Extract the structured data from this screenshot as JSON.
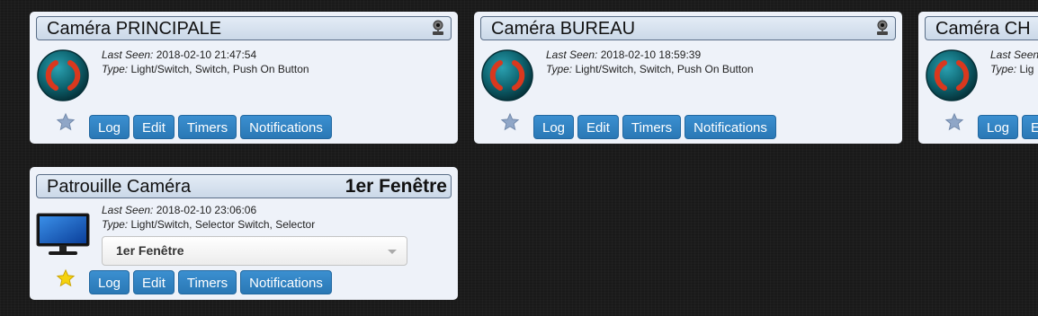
{
  "colors": {
    "background": "#1c1c1c",
    "card": "#eef2f9",
    "header": "#cbd8e8",
    "button": "#3b8fd0",
    "icon_red": "#d9381e",
    "icon_teal": "#0e6470"
  },
  "cards": [
    {
      "title": "Caméra PRINCIPALE",
      "icon": "camera-icon",
      "device_icon": "push-button-icon",
      "last_seen_label": "Last Seen:",
      "last_seen": "2018-02-10 21:47:54",
      "type_label": "Type:",
      "type": "Light/Switch, Switch, Push On Button",
      "favorite": false,
      "buttons": [
        "Log",
        "Edit",
        "Timers",
        "Notifications"
      ]
    },
    {
      "title": "Caméra BUREAU",
      "icon": "camera-icon",
      "device_icon": "push-button-icon",
      "last_seen_label": "Last Seen:",
      "last_seen": "2018-02-10 18:59:39",
      "type_label": "Type:",
      "type": "Light/Switch, Switch, Push On Button",
      "favorite": false,
      "buttons": [
        "Log",
        "Edit",
        "Timers",
        "Notifications"
      ]
    },
    {
      "title": "Caméra CH",
      "icon": "camera-icon",
      "device_icon": "push-button-icon",
      "last_seen_label": "Last Seen:",
      "type_label": "Type:",
      "type": "Lig",
      "favorite": false,
      "buttons": [
        "Log",
        "E"
      ]
    },
    {
      "title": "Patrouille Caméra",
      "status": "1er Fenêtre",
      "device_icon": "monitor-icon",
      "last_seen_label": "Last Seen:",
      "last_seen": "2018-02-10 23:06:06",
      "type_label": "Type:",
      "type": "Light/Switch, Selector Switch, Selector",
      "selector_value": "1er Fenêtre",
      "favorite": true,
      "buttons": [
        "Log",
        "Edit",
        "Timers",
        "Notifications"
      ]
    }
  ]
}
